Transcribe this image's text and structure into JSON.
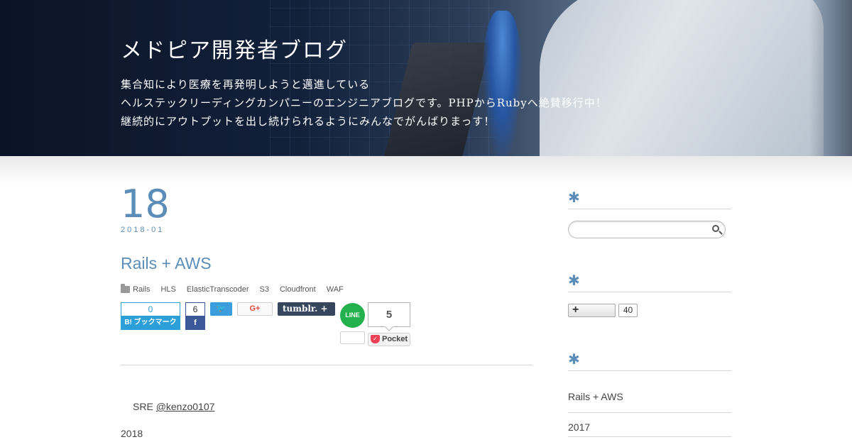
{
  "header": {
    "title": "メドピア開発者ブログ",
    "description_lines": [
      "集合知により医療を再発明しようと邁進している",
      "ヘルステックリーディングカンパニーのエンジニアブログです。PHPからRubyへ絶賛移行中！",
      "継続的にアウトプットを出し続けられるようにみんなでがんばりまっす！"
    ]
  },
  "post": {
    "day": "18",
    "year_month": "2018-01",
    "title": "Rails + AWS",
    "tags": [
      "Rails",
      "HLS",
      "ElasticTranscoder",
      "S3",
      "Cloudfront",
      "WAF"
    ],
    "author_prefix": "SRE",
    "author_handle": "@kenzo0107",
    "body_start": "2018"
  },
  "share": {
    "hatena_count": "0",
    "hatena_label": "B! ブックマーク",
    "facebook_count": "6",
    "facebook_label": "f",
    "twitter_label": "🐦",
    "gplus_label": "G+",
    "tumblr_label": "tumblr. +",
    "line_label": "LINE",
    "pocket_count": "5",
    "pocket_label": "Pocket",
    "colors": {
      "hatena": "#2c9fd8",
      "facebook": "#3b5998",
      "twitter": "#3c9ddc",
      "gplus": "#dd4b39",
      "tumblr": "#35465d",
      "line": "#22b14c",
      "pocket": "#ef4056"
    }
  },
  "sidebar": {
    "widget_marker": "✱",
    "search_placeholder": "",
    "follow_label": "+",
    "follow_count": "40",
    "recent_items": [
      "Rails + AWS",
      "2017"
    ]
  },
  "theme": {
    "accent": "#5b8db8"
  }
}
